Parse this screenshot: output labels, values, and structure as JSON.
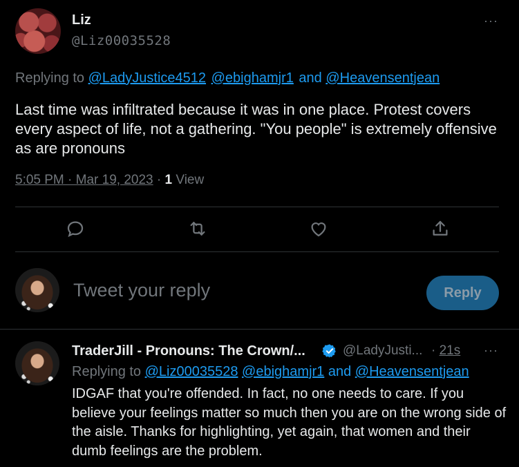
{
  "main_tweet": {
    "author_name": "Liz",
    "author_handle": "@Liz00035528",
    "more_label": "···",
    "replying_prefix": "Replying to",
    "replying_to": [
      "@LadyJustice4512",
      "@ebighamjr1"
    ],
    "replying_and": "and",
    "replying_last": "@Heavensentjean",
    "text": "Last time was infiltrated because it was in one place. Protest covers every aspect of life, not a gathering. \"You people\" is extremely offensive as are pronouns",
    "timestamp": "5:05 PM · Mar 19, 2023",
    "meta_separator": "·",
    "view_count": "1",
    "view_label": "View",
    "actions": [
      "reply-icon",
      "retweet-icon",
      "like-icon",
      "share-icon"
    ]
  },
  "composer": {
    "placeholder": "Tweet your reply",
    "reply_button": "Reply"
  },
  "reply_tweet": {
    "author_name": "TraderJill - Pronouns: The Crown/...",
    "verified": true,
    "author_handle": "@LadyJusti...",
    "time_separator": "·",
    "time": "21s",
    "more_label": "···",
    "replying_prefix": "Replying to",
    "replying_to": [
      "@Liz00035528",
      "@ebighamjr1"
    ],
    "replying_and": "and",
    "replying_last": "@Heavensentjean",
    "text": "IDGAF that you're offended. In fact, no one needs to care. If you believe your feelings matter so much then you are on the wrong side of the aisle. Thanks for highlighting, yet again, that women and their dumb feelings are the problem."
  },
  "colors": {
    "background": "#000000",
    "text": "#e7e9ea",
    "muted": "#71767b",
    "link": "#1d9bf0",
    "divider": "#2f3336",
    "reply_button_bg": "#1a5d88"
  }
}
